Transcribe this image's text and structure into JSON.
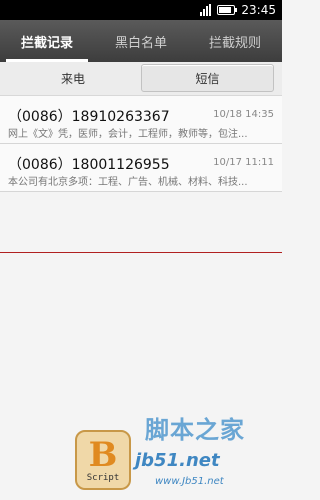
{
  "status_bar": {
    "time": "23:45"
  },
  "tabs": [
    {
      "label": "拦截记录",
      "active": true
    },
    {
      "label": "黑白名单",
      "active": false
    },
    {
      "label": "拦截规则",
      "active": false
    }
  ],
  "segments": {
    "calls": "来电",
    "sms": "短信",
    "selected": "sms"
  },
  "messages": [
    {
      "number": "（0086）18910263367",
      "time": "10/18 14:35",
      "preview": "网上《文》凭，医师，会计，工程师，教师等，包注..."
    },
    {
      "number": "（0086）18001126955",
      "time": "10/17 11:11",
      "preview": "本公司有北京多项：工程、广告、机械、材料、科技..."
    }
  ],
  "watermark": {
    "letter": "B",
    "script": "Script",
    "site_cn": "脚本之家",
    "site_url": "jb51.net",
    "site_url2": "www.Jb51.net"
  },
  "colors": {
    "tab_bar": "#4a4a4a",
    "divider": "#b02020",
    "watermark_blue": "#3f87c2"
  }
}
